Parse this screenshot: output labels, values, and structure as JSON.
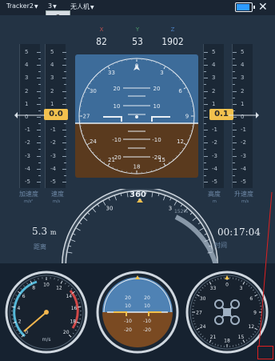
{
  "topbar": {
    "tracker": "Tracker2",
    "num": "3",
    "uav": "无人机",
    "popup_value": "3",
    "battery_level": 0.9
  },
  "xyz": {
    "x_label": "X",
    "x_value": "82",
    "y_label": "Y",
    "y_value": "53",
    "z_label": "Z",
    "z_value": "1902"
  },
  "accel": {
    "label": "加速度",
    "unit": "m/s²",
    "ticks": [
      "5",
      "4",
      "3",
      "2",
      "1",
      "0",
      "-1",
      "-2",
      "-3",
      "-4",
      "-5"
    ]
  },
  "speed": {
    "label": "速度",
    "unit": "m/s",
    "value": "0.0",
    "ticks": [
      "5",
      "4",
      "3",
      "2",
      "1",
      "0",
      "-1",
      "-2",
      "-3",
      "-4",
      "-5"
    ]
  },
  "altitude": {
    "label": "高度",
    "unit": "m",
    "value": "0.1",
    "ticks": [
      "5",
      "4",
      "3",
      "2",
      "1",
      "0",
      "-1",
      "-2",
      "-3",
      "-4",
      "-5"
    ]
  },
  "climb": {
    "label": "升速度",
    "unit": "m/s",
    "ticks": [
      "5",
      "4",
      "3",
      "2",
      "1",
      "0",
      "-1",
      "-2",
      "-3",
      "-4",
      "-5"
    ]
  },
  "attitude": {
    "pitch_ticks": [
      "20",
      "10",
      "-10",
      "-20"
    ],
    "compass": [
      "0",
      "3",
      "6",
      "9",
      "12",
      "15",
      "18",
      "21",
      "24",
      "27",
      "30",
      "33"
    ]
  },
  "heading": {
    "value": "360",
    "ticks": [
      "30",
      "0",
      "3"
    ],
    "percent_label": "152%"
  },
  "distance": {
    "value": "5.3",
    "unit": "m",
    "label": "距离"
  },
  "time": {
    "value": "00:17:04",
    "label": "时间"
  },
  "speed_gauge": {
    "ticks": [
      "0",
      "2",
      "4",
      "6",
      "8",
      "10",
      "12",
      "14",
      "16",
      "18",
      "20"
    ],
    "unit": "m/s"
  },
  "mini_ai": {
    "ticks": [
      "20",
      "10",
      "10",
      "20",
      "-10",
      "-20",
      "-10",
      "-20"
    ]
  },
  "mini_compass": {
    "ticks": [
      "0",
      "3",
      "6",
      "9",
      "12",
      "15",
      "18",
      "21",
      "24",
      "27",
      "30",
      "33"
    ]
  }
}
